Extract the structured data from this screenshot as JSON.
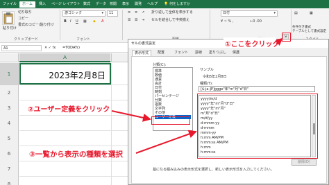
{
  "ribbon": {
    "tabs": [
      "ファイル",
      "ホーム",
      "挿入",
      "ページ レイアウト",
      "数式",
      "データ",
      "校閲",
      "表示",
      "開発",
      "ヘルプ"
    ],
    "active_tab": "ホーム",
    "help_search": "何をしますか",
    "clipboard": {
      "cut": "切り取り",
      "copy": "コピー",
      "format_copy": "書式のコピー/貼り付け",
      "group": "クリップボード",
      "paste": "貼り付け"
    },
    "font_name": "游ゴシック",
    "font_size": "11",
    "wrap_text": "折り返して全体を表示する",
    "merge_center": "セルを結合して中央揃え",
    "number_format": "日付",
    "font_group": "フォント",
    "align_group": "配置",
    "number_group": "数値",
    "styles": {
      "conditional": "条件付き書式",
      "table": "テーブルとして書式設定",
      "group": "スタイル"
    }
  },
  "formula_bar": {
    "name_box": "A1",
    "formula": "=TODAY()"
  },
  "grid": {
    "col_a": "A",
    "col_b": "B",
    "rows": [
      "1",
      "2",
      "3",
      "4",
      "5",
      "6",
      "7",
      "8"
    ],
    "cell_a1": "2023年2月8日"
  },
  "dialog": {
    "title": "セルの書式設定",
    "tabs": [
      "表示形式",
      "配置",
      "フォント",
      "罫線",
      "塗りつぶし",
      "保護"
    ],
    "category_label": "分類(C):",
    "categories": [
      "標準",
      "数値",
      "通貨",
      "会計",
      "日付",
      "時刻",
      "パーセンテージ",
      "分数",
      "指数",
      "文字列",
      "その他",
      "ユーザー定義"
    ],
    "selected_category": "ユーザー定義",
    "sample_label": "サンプル",
    "sample_value": "令和5年2月8日",
    "type_label": "種類(T):",
    "type_value": "[$-ja-JP]ggge\"年\"m\"月\"d\"日\"",
    "formats": [
      "yyyy/m/d",
      "yyyy\"年\"m\"月\"d\"日\"",
      "yyyy\"年\"m\"月\"",
      "m\"月\"d\"日\"",
      "m/d/yy",
      "d-mmm-yy",
      "d-mmm",
      "mmm-yy",
      "h:mm AM/PM",
      "h:mm:ss AM/PM",
      "h:mm",
      "h:mm:ss"
    ],
    "delete_button": "削除(D)",
    "footnote": "基になる組み込みの表示形式を選択し、新しい表示形式を入力してください。"
  },
  "annotations": {
    "step1": "①ここをクリック",
    "step2": "②ユーザー定義をクリック",
    "step3": "③一覧から表示の種類を選択"
  },
  "colors": {
    "excel_green": "#1e7145",
    "annotation_red": "#e8182c",
    "selection_blue": "#0a64c8"
  }
}
